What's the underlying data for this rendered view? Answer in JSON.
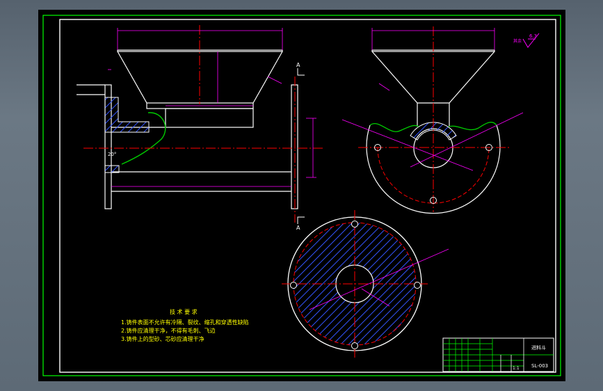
{
  "drawing": {
    "tech_req_title": "技 术 要 求",
    "tech_req_lines": [
      "1.铸件表面不允许有冷隔、裂纹、缩孔和穿透性缺陷",
      "2.铸件应清理干净，不得有毛刺、飞边",
      "3.铸件上的型砂、芯砂应清理干净"
    ],
    "section_marker": "A",
    "angle_label": "20°",
    "roughness_note": "其余",
    "roughness_value": "6.3",
    "title_block": {
      "drawing_no": "SL-003",
      "name": "进料斗",
      "scale": "1:1"
    }
  },
  "colors": {
    "frame": "#00ff00",
    "lines": "#ffffff",
    "dimensions": "#ff00ff",
    "centerlines": "#ff0000",
    "hatch": "#3355ff",
    "text": "#ffff00",
    "curve": "#00cc00"
  }
}
